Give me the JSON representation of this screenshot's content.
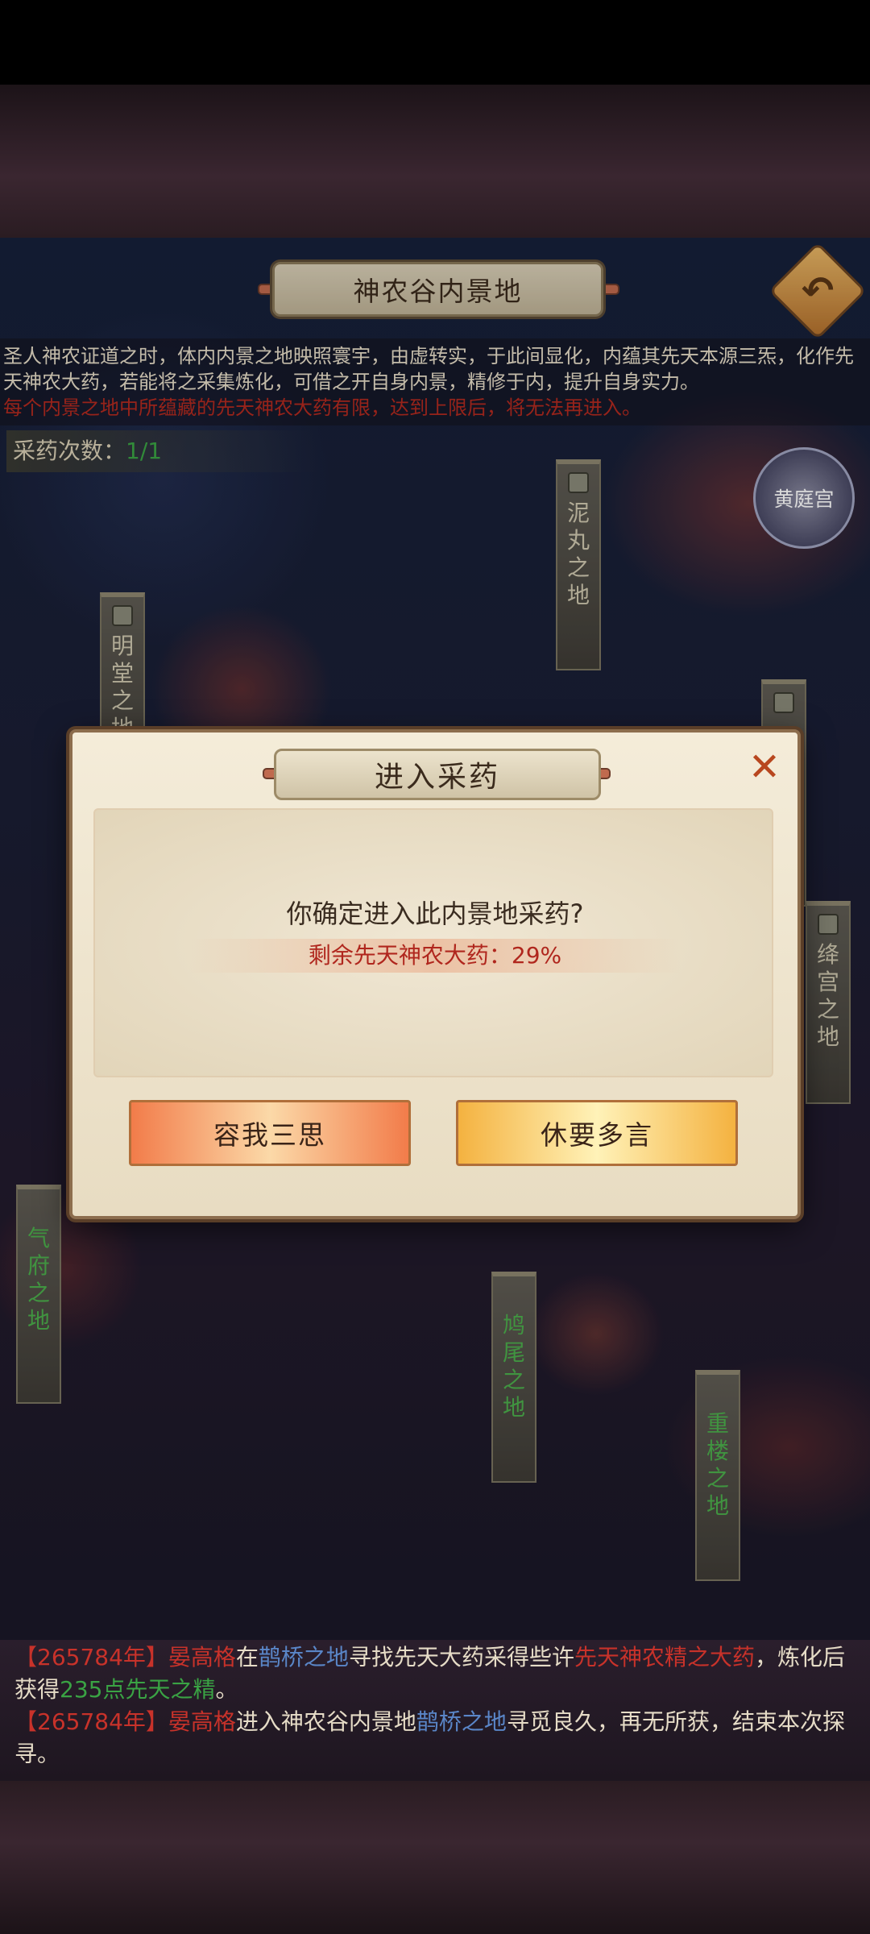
{
  "header": {
    "title": "神农谷内景地",
    "back_icon": "back-arrow-icon"
  },
  "intro": {
    "line1": "圣人神农证道之时，体内内景之地映照寰宇，由虚转实，于此间显化，内蕴其先天本源三炁，化作先天神农大药，若能将之采集炼化，可借之开自身内景，精修于内，提升自身实力。",
    "line2": "每个内景之地中所蕴藏的先天神农大药有限，达到上限后，将无法再进入。"
  },
  "herb_count": {
    "label": "采药次数：",
    "value": "1/1"
  },
  "huangting": "黄庭宫",
  "locations": {
    "niwan": [
      "泥",
      "丸",
      "之",
      "地"
    ],
    "mingtang": [
      "明",
      "堂",
      "之",
      "地"
    ],
    "jianggong": [
      "绛",
      "宫",
      "之",
      "地"
    ],
    "qifu": [
      "气",
      "府",
      "之",
      "地"
    ],
    "jiuwei": [
      "鸠",
      "尾",
      "之",
      "地"
    ],
    "chonglou": [
      "重",
      "楼",
      "之",
      "地"
    ]
  },
  "dialog": {
    "title": "进入采药",
    "question": "你确定进入此内景地采药?",
    "remaining": "剩余先天神农大药：29%",
    "cancel_label": "容我三思",
    "confirm_label": "休要多言",
    "close_icon": "close-icon"
  },
  "log": {
    "e1_year": "【265784年】",
    "e1_name": "晏高格",
    "e1_t1": "在",
    "e1_place": "鹊桥之地",
    "e1_t2": "寻找先天大药采得些许",
    "e1_item": "先天神农精之大药",
    "e1_t3": "，炼化后获得",
    "e1_reward": "235点先天之精",
    "e1_t4": "。",
    "e2_year": "【265784年】",
    "e2_name": "晏高格",
    "e2_t1": "进入神农谷内景地",
    "e2_place": "鹊桥之地",
    "e2_t2": "寻觅良久，再无所获，结束本次探寻。"
  },
  "colors": {
    "accent_red": "#b0261d",
    "green": "#3aa344",
    "gold": "#f4b240"
  }
}
